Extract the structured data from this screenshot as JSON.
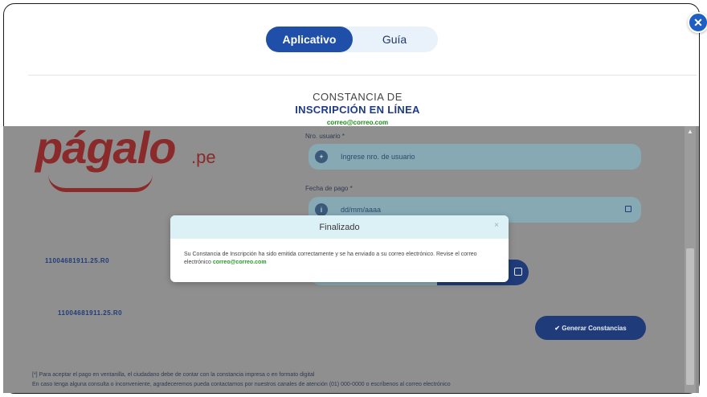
{
  "header": {
    "close_icon": "close-icon",
    "tabs": [
      {
        "label": "Aplicativo",
        "active": true
      },
      {
        "label": "Guía",
        "active": false
      }
    ],
    "title_line1": "CONSTANCIA DE",
    "title_line2": "INSCRIPCIÓN EN LÍNEA",
    "email": "correo@correo.com"
  },
  "background_page": {
    "logo_text": "págalo",
    "logo_suffix": ".pe",
    "field1_label": "Nro. usuario *",
    "field1_placeholder": "Ingrese nro. de usuario",
    "field2_label": "Fecha de pago *",
    "field2_placeholder": "dd/mm/aaaa",
    "left_code_1": "11004681911.25.R0",
    "left_code_2": "11004681911.25.R0",
    "generate_button": "✔ Generar Constancias",
    "footer_line1": "[*] Para aceptar el pago en ventanilla, el ciudadano debe de contar con la constancia impresa o en formato digital",
    "footer_line2": "En caso tenga alguna consulta o inconveniente, agradeceremos pueda contactarnos por nuestros canales de atención (01) 000-0000 o escríbenos al correo electrónico"
  },
  "modal": {
    "title": "Finalizado",
    "body_text": "Su Constancia de Inscripción ha sido emitida correctamente y se ha enviado a su correo electrónico. Revise el correo electrónico",
    "body_email": "correo@correo.com"
  },
  "colors": {
    "accent": "#1f4fa8",
    "brand": "#8a2a2a",
    "overlay_grey": "#8f8f8f",
    "modal_header": "#dcf1f5"
  }
}
